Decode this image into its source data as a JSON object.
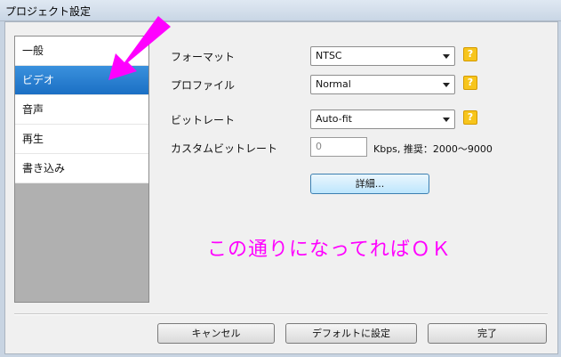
{
  "window": {
    "title": "プロジェクト設定"
  },
  "sidebar": {
    "items": [
      {
        "label": "一般"
      },
      {
        "label": "ビデオ"
      },
      {
        "label": "音声"
      },
      {
        "label": "再生"
      },
      {
        "label": "書き込み"
      }
    ]
  },
  "settings": {
    "format": {
      "label": "フォーマット",
      "value": "NTSC"
    },
    "profile": {
      "label": "プロファイル",
      "value": "Normal"
    },
    "bitrate": {
      "label": "ビットレート",
      "value": "Auto-fit"
    },
    "custom_bitrate": {
      "label": "カスタムビットレート",
      "placeholder": "0",
      "hint": "Kbps, 推奨：2000～9000"
    },
    "help_glyph": "?",
    "detail_button": "詳細..."
  },
  "annotation": {
    "text": "この通りになってればＯＫ",
    "color": "#ff00ff",
    "arrow_icon": "magenta-arrow-icon"
  },
  "footer": {
    "cancel": "キャンセル",
    "set_default": "デフォルトに設定",
    "done": "完了"
  }
}
